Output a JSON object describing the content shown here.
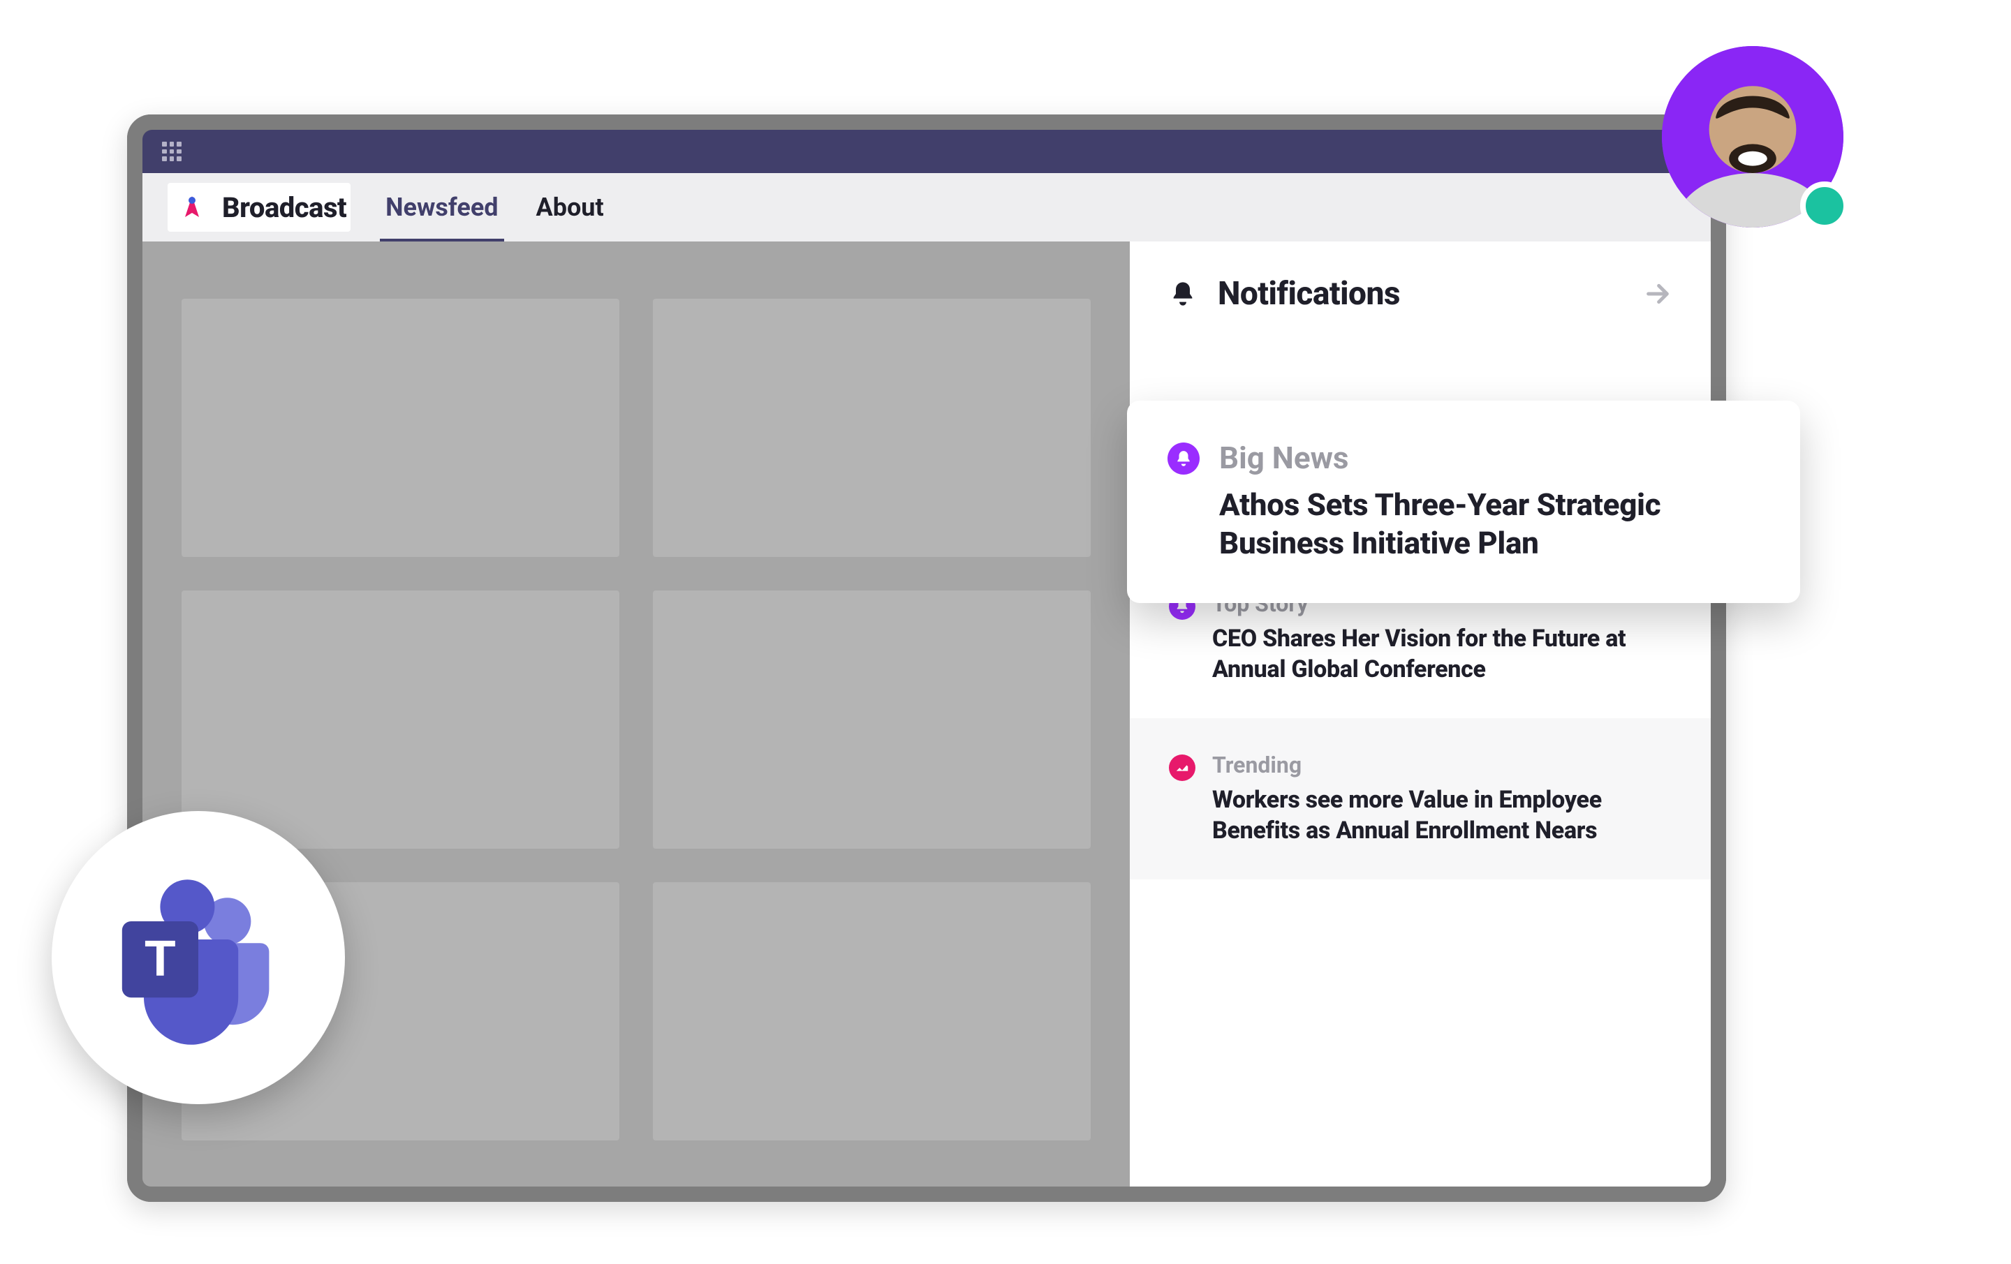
{
  "app": {
    "name": "Broadcast"
  },
  "tabs": [
    {
      "label": "Newsfeed",
      "active": true
    },
    {
      "label": "About",
      "active": false
    }
  ],
  "notifications": {
    "title": "Notifications",
    "featured": {
      "category": "Big News",
      "headline": "Athos Sets Three-Year Strategic Business Initiative Plan",
      "icon_color": "purple",
      "icon": "bell"
    },
    "items": [
      {
        "category": "Top Story",
        "headline": "CEO Shares Her Vision for the Future at Annual Global Conference",
        "icon_color": "purple",
        "icon": "bell",
        "alt": false
      },
      {
        "category": "Trending",
        "headline": "Workers see more Value in Employee Benefits as Annual Enrollment Nears",
        "icon_color": "pink",
        "icon": "trend",
        "alt": true
      }
    ]
  },
  "colors": {
    "titlebar": "#413f6b",
    "accent_purple": "#9a2dff",
    "accent_pink": "#e7196b",
    "presence": "#1bc2a0"
  }
}
